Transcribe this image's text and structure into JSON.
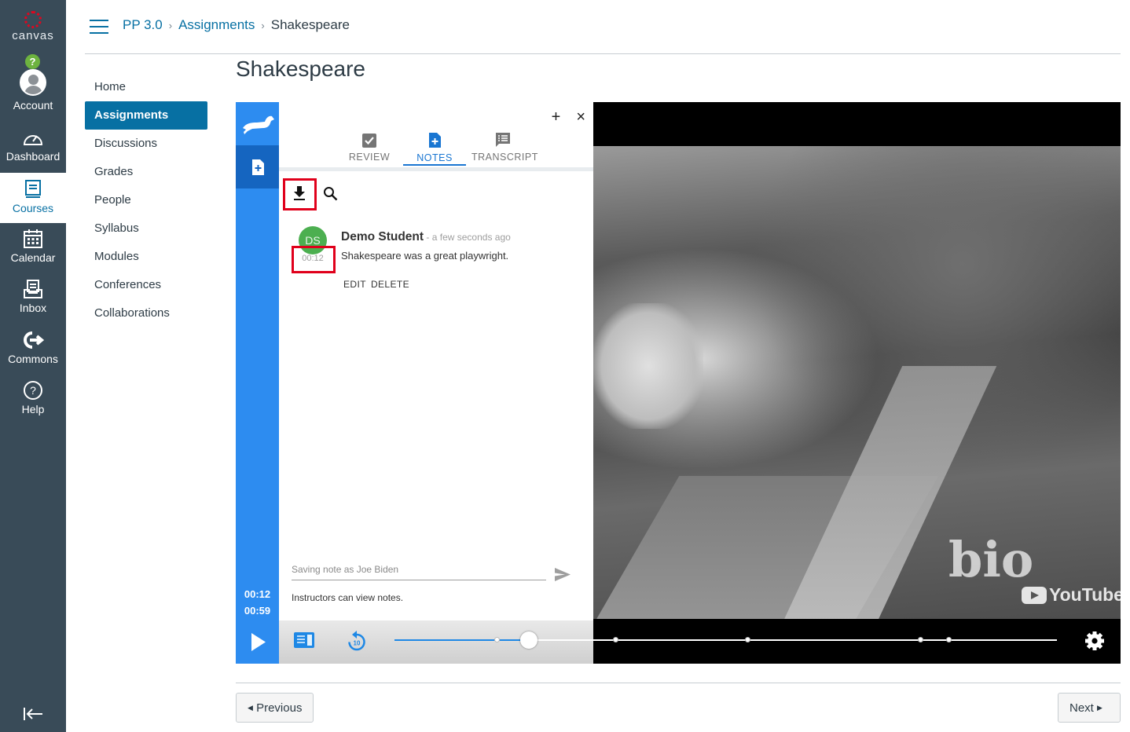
{
  "global_nav": {
    "logo_text": "canvas",
    "items": [
      {
        "label": "Account",
        "icon": "user-avatar-icon"
      },
      {
        "label": "Dashboard",
        "icon": "dashboard-icon"
      },
      {
        "label": "Courses",
        "icon": "courses-icon"
      },
      {
        "label": "Calendar",
        "icon": "calendar-icon"
      },
      {
        "label": "Inbox",
        "icon": "inbox-icon"
      },
      {
        "label": "Commons",
        "icon": "commons-icon"
      },
      {
        "label": "Help",
        "icon": "help-icon"
      }
    ],
    "help_badge": "?",
    "active": "Courses"
  },
  "breadcrumb": {
    "course": "PP 3.0",
    "section": "Assignments",
    "current": "Shakespeare"
  },
  "course_nav": {
    "items": [
      "Home",
      "Assignments",
      "Discussions",
      "Grades",
      "People",
      "Syllabus",
      "Modules",
      "Conferences",
      "Collaborations"
    ],
    "active": "Assignments"
  },
  "page": {
    "title": "Shakespeare"
  },
  "notes_panel": {
    "top_actions": {
      "add": "+",
      "close": "×"
    },
    "tabs": [
      {
        "label": "REVIEW",
        "icon": "clipboard-check-icon"
      },
      {
        "label": "NOTES",
        "icon": "note-add-icon"
      },
      {
        "label": "TRANSCRIPT",
        "icon": "transcript-icon"
      }
    ],
    "active_tab": "NOTES",
    "note": {
      "initials": "DS",
      "author": "Demo Student",
      "when": " - a few seconds ago",
      "timestamp": "00:12",
      "text": "Shakespeare was a great playwright.",
      "actions": [
        "EDIT",
        "DELETE"
      ]
    },
    "input_placeholder": "Saving note as Joe Biden",
    "hint": "Instructors can view notes."
  },
  "player": {
    "current_time": "00:12",
    "duration": "00:59",
    "progress_fraction": 0.2034,
    "marker_fractions": [
      0.155,
      0.334,
      0.533,
      0.794,
      0.837
    ],
    "watermark": "bio",
    "youtube_label": "YouTube"
  },
  "footer": {
    "previous": "Previous",
    "next": "Next"
  },
  "colors": {
    "nav_bg": "#394b58",
    "brand_blue": "#0770a3",
    "rail_blue": "#2d8cf0",
    "highlight_red": "#e0001b"
  }
}
